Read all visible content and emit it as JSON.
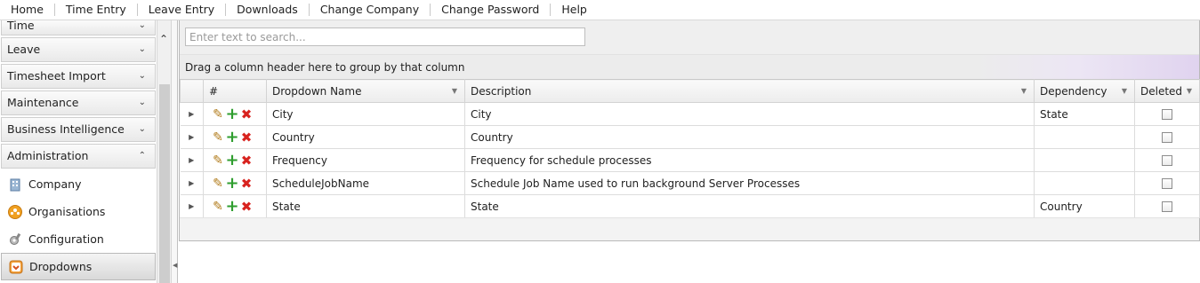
{
  "menu": [
    "Home",
    "Time Entry",
    "Leave Entry",
    "Downloads",
    "Change Company",
    "Change Password",
    "Help"
  ],
  "sidebar": {
    "groups": [
      "Time",
      "Leave",
      "Timesheet Import",
      "Maintenance",
      "Business Intelligence",
      "Administration"
    ],
    "items": [
      {
        "label": "Company",
        "icon": "company-icon"
      },
      {
        "label": "Organisations",
        "icon": "organisations-icon"
      },
      {
        "label": "Configuration",
        "icon": "configuration-icon"
      },
      {
        "label": "Dropdowns",
        "icon": "dropdowns-icon",
        "selected": true
      }
    ]
  },
  "grid": {
    "search_placeholder": "Enter text to search...",
    "group_hint": "Drag a column header here to group by that column",
    "columns": {
      "num": "#",
      "name": "Dropdown Name",
      "description": "Description",
      "dependency": "Dependency",
      "deleted": "Deleted"
    },
    "rows": [
      {
        "name": "City",
        "description": "City",
        "dependency": "State",
        "deleted": false
      },
      {
        "name": "Country",
        "description": "Country",
        "dependency": "",
        "deleted": false
      },
      {
        "name": "Frequency",
        "description": "Frequency for schedule processes",
        "dependency": "",
        "deleted": false
      },
      {
        "name": "ScheduleJobName",
        "description": "Schedule Job Name used to run background Server Processes",
        "dependency": "",
        "deleted": false
      },
      {
        "name": "State",
        "description": "State",
        "dependency": "Country",
        "deleted": false
      }
    ]
  },
  "colors": {
    "edit": "#b07a18",
    "add": "#2f9e2f",
    "delete": "#d8231f"
  }
}
